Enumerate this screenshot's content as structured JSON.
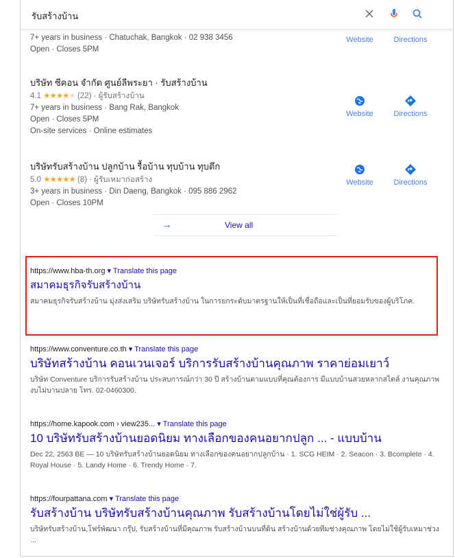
{
  "search": {
    "query": "รับสร้างบ้าน",
    "icons": [
      "close-icon",
      "mic-icon",
      "search-icon"
    ]
  },
  "local": {
    "top_partial": {
      "line1": "7+ years in business · Chatuchak, Bangkok · 02 938 3456",
      "line2": "Open · Closes 5PM",
      "website": "Website",
      "directions": "Directions"
    },
    "businesses": [
      {
        "name": "บริษัท ซีคอน จำกัด ศูนย์ลีพระยา · รับสร้างบ้าน",
        "rating": "4.1",
        "stars_filled": 4,
        "reviews": "(22) · ผู้รับสร้างบ้าน",
        "line1": "7+ years in business · Bang Rak, Bangkok",
        "line2": "Open · Closes 5PM",
        "line3": "On-site services · Online estimates",
        "website": "Website",
        "directions": "Directions"
      },
      {
        "name": "บริษัทรับสร้างบ้าน ปลูกบ้าน รื้อบ้าน ทุบบ้าน ทุบตึก",
        "rating": "5.0",
        "stars_filled": 5,
        "reviews": "(8) · ผู้รับเหมาก่อสร้าง",
        "line1": "3+ years in business · Din Daeng, Bangkok · 095 886 2962",
        "line2": "Open · Closes 10PM",
        "website": "Website",
        "directions": "Directions"
      }
    ],
    "view_all": "View all"
  },
  "results": [
    {
      "url": "https://www.hba-th.org",
      "translate": "▾ Translate this page",
      "title": "สมาคมธุรกิจรับสร้างบ้าน",
      "snippet": "สมาคมธุรกิจรับสร้างบ้าน มุ่งส่งเสริม บริษัทรับสร้างบ้าน ในการยกระดับมาตรฐานให้เป็นที่เชื่อถือและเป็นที่ยอมรับของผู้บริโภค."
    },
    {
      "url": "https://www.conventure.co.th",
      "translate": "▾ Translate this page",
      "title": "บริษัทสร้างบ้าน คอนเวนเจอร์ บริการรับสร้างบ้านคุณภาพ ราคาย่อมเยาว์",
      "snippet": "บริษัท Conventure บริการรับสร้างบ้าน ประสบการณ์กว่า 30 ปี สร้างบ้านตามแบบที่คุณต้องการ มีแบบบ้านสวยหลากสไตล์ งานคุณภาพ งบไม่บานปลาย โทร. 02-0460300."
    },
    {
      "url": "https://home.kapook.com › view235...",
      "translate": "▾ Translate this page",
      "title": "10 บริษัทรับสร้างบ้านยอดนิยม ทางเลือกของคนอยากปลูก ... - แบบบ้าน",
      "snippet": "Dec 22, 2563 BE — 10 บริษัทรับสร้างบ้านยอดนิยม ทางเลือกของคนอยากปลูกบ้าน · 1. SCG HEIM · 2. Seacon · 3. Bcomplete · 4. Royal House · 5. Landy Home · 6. Trendy Home · 7."
    },
    {
      "url": "https://fourpattana.com",
      "translate": "▾ Translate this page",
      "title": "รับสร้างบ้าน บริษัทรับสร้างบ้านคุณภาพ รับสร้างบ้านโดยไม่ใช่ผู้รับ ...",
      "snippet": "บริษัทรับสร้างบ้าน,โฟร์พัฒนา กรุ๊ป, รับสร้างบ้านที่มีคุณภาพ รับสร้างบ้านบนที่ดิน สร้างบ้านด้วยทีมช่างคุณภาพ โดยไม่ใช้ผู้รับเหมาช่วง ..."
    }
  ],
  "colors": {
    "link": "#1a0dab",
    "highlight_border": "#e01b1b",
    "star": "#f5a623",
    "action_blue": "#1a73e8"
  }
}
